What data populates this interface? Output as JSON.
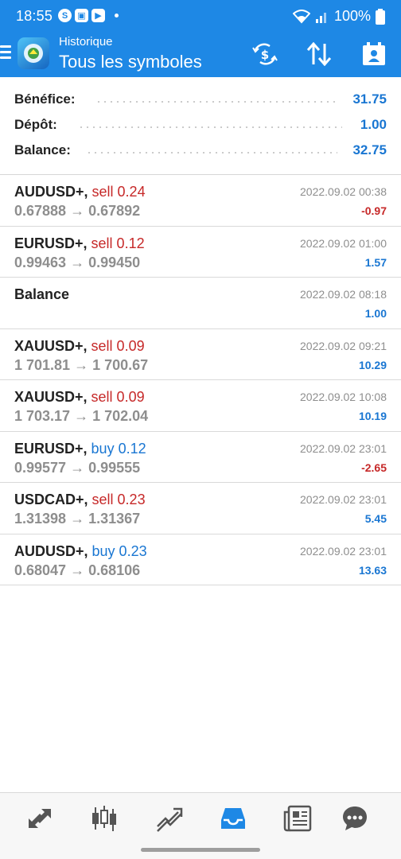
{
  "status": {
    "time": "18:55",
    "battery": "100%",
    "left_icons": [
      "shazam-icon",
      "photo-icon",
      "youtube-icon"
    ]
  },
  "appbar": {
    "subtitle": "Historique",
    "title": "Tous les symboles",
    "actions": [
      "currency-exchange-icon",
      "sort-icon",
      "calendar-icon"
    ]
  },
  "summary": {
    "profit_label": "Bénéfice:",
    "profit_value": "31.75",
    "deposit_label": "Dépôt:",
    "deposit_value": "1.00",
    "balance_label": "Balance:",
    "balance_value": "32.75"
  },
  "deals": [
    {
      "symbol": "AUDUSD+,",
      "type": "sell 0.24",
      "side": "sell",
      "prices": "0.67888 → 0.67892",
      "time": "2022.09.02 00:38",
      "profit": "-0.97",
      "sign": "neg"
    },
    {
      "symbol": "EURUSD+,",
      "type": "sell 0.12",
      "side": "sell",
      "prices": "0.99463 → 0.99450",
      "time": "2022.09.02 01:00",
      "profit": "1.57",
      "sign": "pos"
    },
    {
      "symbol": "Balance",
      "type": "",
      "side": "",
      "prices": "",
      "time": "2022.09.02 08:18",
      "profit": "1.00",
      "sign": "pos"
    },
    {
      "symbol": "XAUUSD+,",
      "type": "sell 0.09",
      "side": "sell",
      "prices": "1 701.81 → 1 700.67",
      "time": "2022.09.02 09:21",
      "profit": "10.29",
      "sign": "pos"
    },
    {
      "symbol": "XAUUSD+,",
      "type": "sell 0.09",
      "side": "sell",
      "prices": "1 703.17 → 1 702.04",
      "time": "2022.09.02 10:08",
      "profit": "10.19",
      "sign": "pos"
    },
    {
      "symbol": "EURUSD+,",
      "type": "buy 0.12",
      "side": "buy",
      "prices": "0.99577 → 0.99555",
      "time": "2022.09.02 23:01",
      "profit": "-2.65",
      "sign": "neg"
    },
    {
      "symbol": "USDCAD+,",
      "type": "sell 0.23",
      "side": "sell",
      "prices": "1.31398 → 1.31367",
      "time": "2022.09.02 23:01",
      "profit": "5.45",
      "sign": "pos"
    },
    {
      "symbol": "AUDUSD+,",
      "type": "buy 0.23",
      "side": "buy",
      "prices": "0.68047 → 0.68106",
      "time": "2022.09.02 23:01",
      "profit": "13.63",
      "sign": "pos"
    }
  ],
  "bottom_nav": {
    "items": [
      "quotes-icon",
      "chart-icon",
      "trade-icon",
      "history-icon",
      "news-icon",
      "chat-icon"
    ],
    "active": "history-icon"
  },
  "colors": {
    "accent": "#1e88e5",
    "sell": "#c62828",
    "buy": "#1976d2",
    "muted": "#8e8e8e"
  }
}
